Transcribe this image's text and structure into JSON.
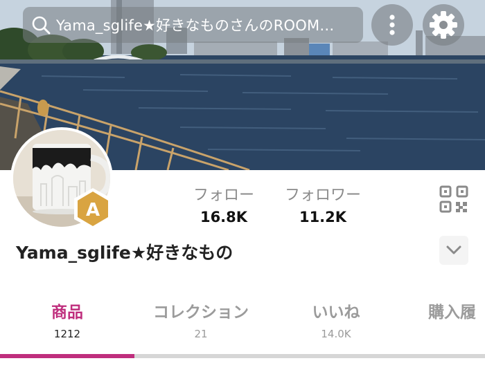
{
  "header": {
    "search": {
      "query": "Yama_sglife★好きなものさんのROOM…",
      "icon": "search-icon"
    },
    "more_icon": "more-vertical-icon",
    "settings_icon": "gear-icon"
  },
  "profile": {
    "avatar_badge": "A",
    "username": "Yama_sglife★好きなもの",
    "stats": {
      "follow_label": "フォロー",
      "follow_value": "16.8K",
      "follower_label": "フォロワー",
      "follower_value": "11.2K"
    },
    "qr_icon": "qr-code-icon",
    "expand_icon": "chevron-down-icon"
  },
  "tabs": [
    {
      "label": "商品",
      "count": "1212",
      "active": true
    },
    {
      "label": "コレクション",
      "count": "21",
      "active": false
    },
    {
      "label": "いいね",
      "count": "14.0K",
      "active": false
    },
    {
      "label": "購入履",
      "count": "",
      "active": false
    }
  ],
  "colors": {
    "accent": "#bf2e7d",
    "inactive_tab": "#9b9b9b",
    "badge_gold": "#d9a441"
  }
}
